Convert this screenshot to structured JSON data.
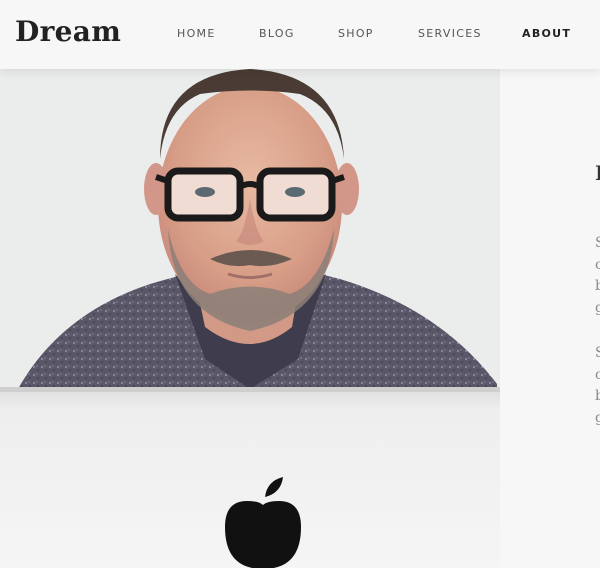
{
  "brand": {
    "name": "Dream"
  },
  "nav": {
    "items": [
      {
        "label": "HOME"
      },
      {
        "label": "BLOG"
      },
      {
        "label": "SHOP"
      },
      {
        "label": "SERVICES"
      },
      {
        "label": "ABOUT",
        "active": true
      }
    ]
  },
  "about": {
    "heading_partial": "I",
    "paragraph_1_lines": [
      "S",
      "c",
      "b",
      "g"
    ],
    "paragraph_2_lines": [
      "S",
      "c",
      "b",
      "g"
    ]
  },
  "colors": {
    "background": "#f7f7f7",
    "text_dark": "#222222",
    "text_muted": "#8a8a8a"
  }
}
